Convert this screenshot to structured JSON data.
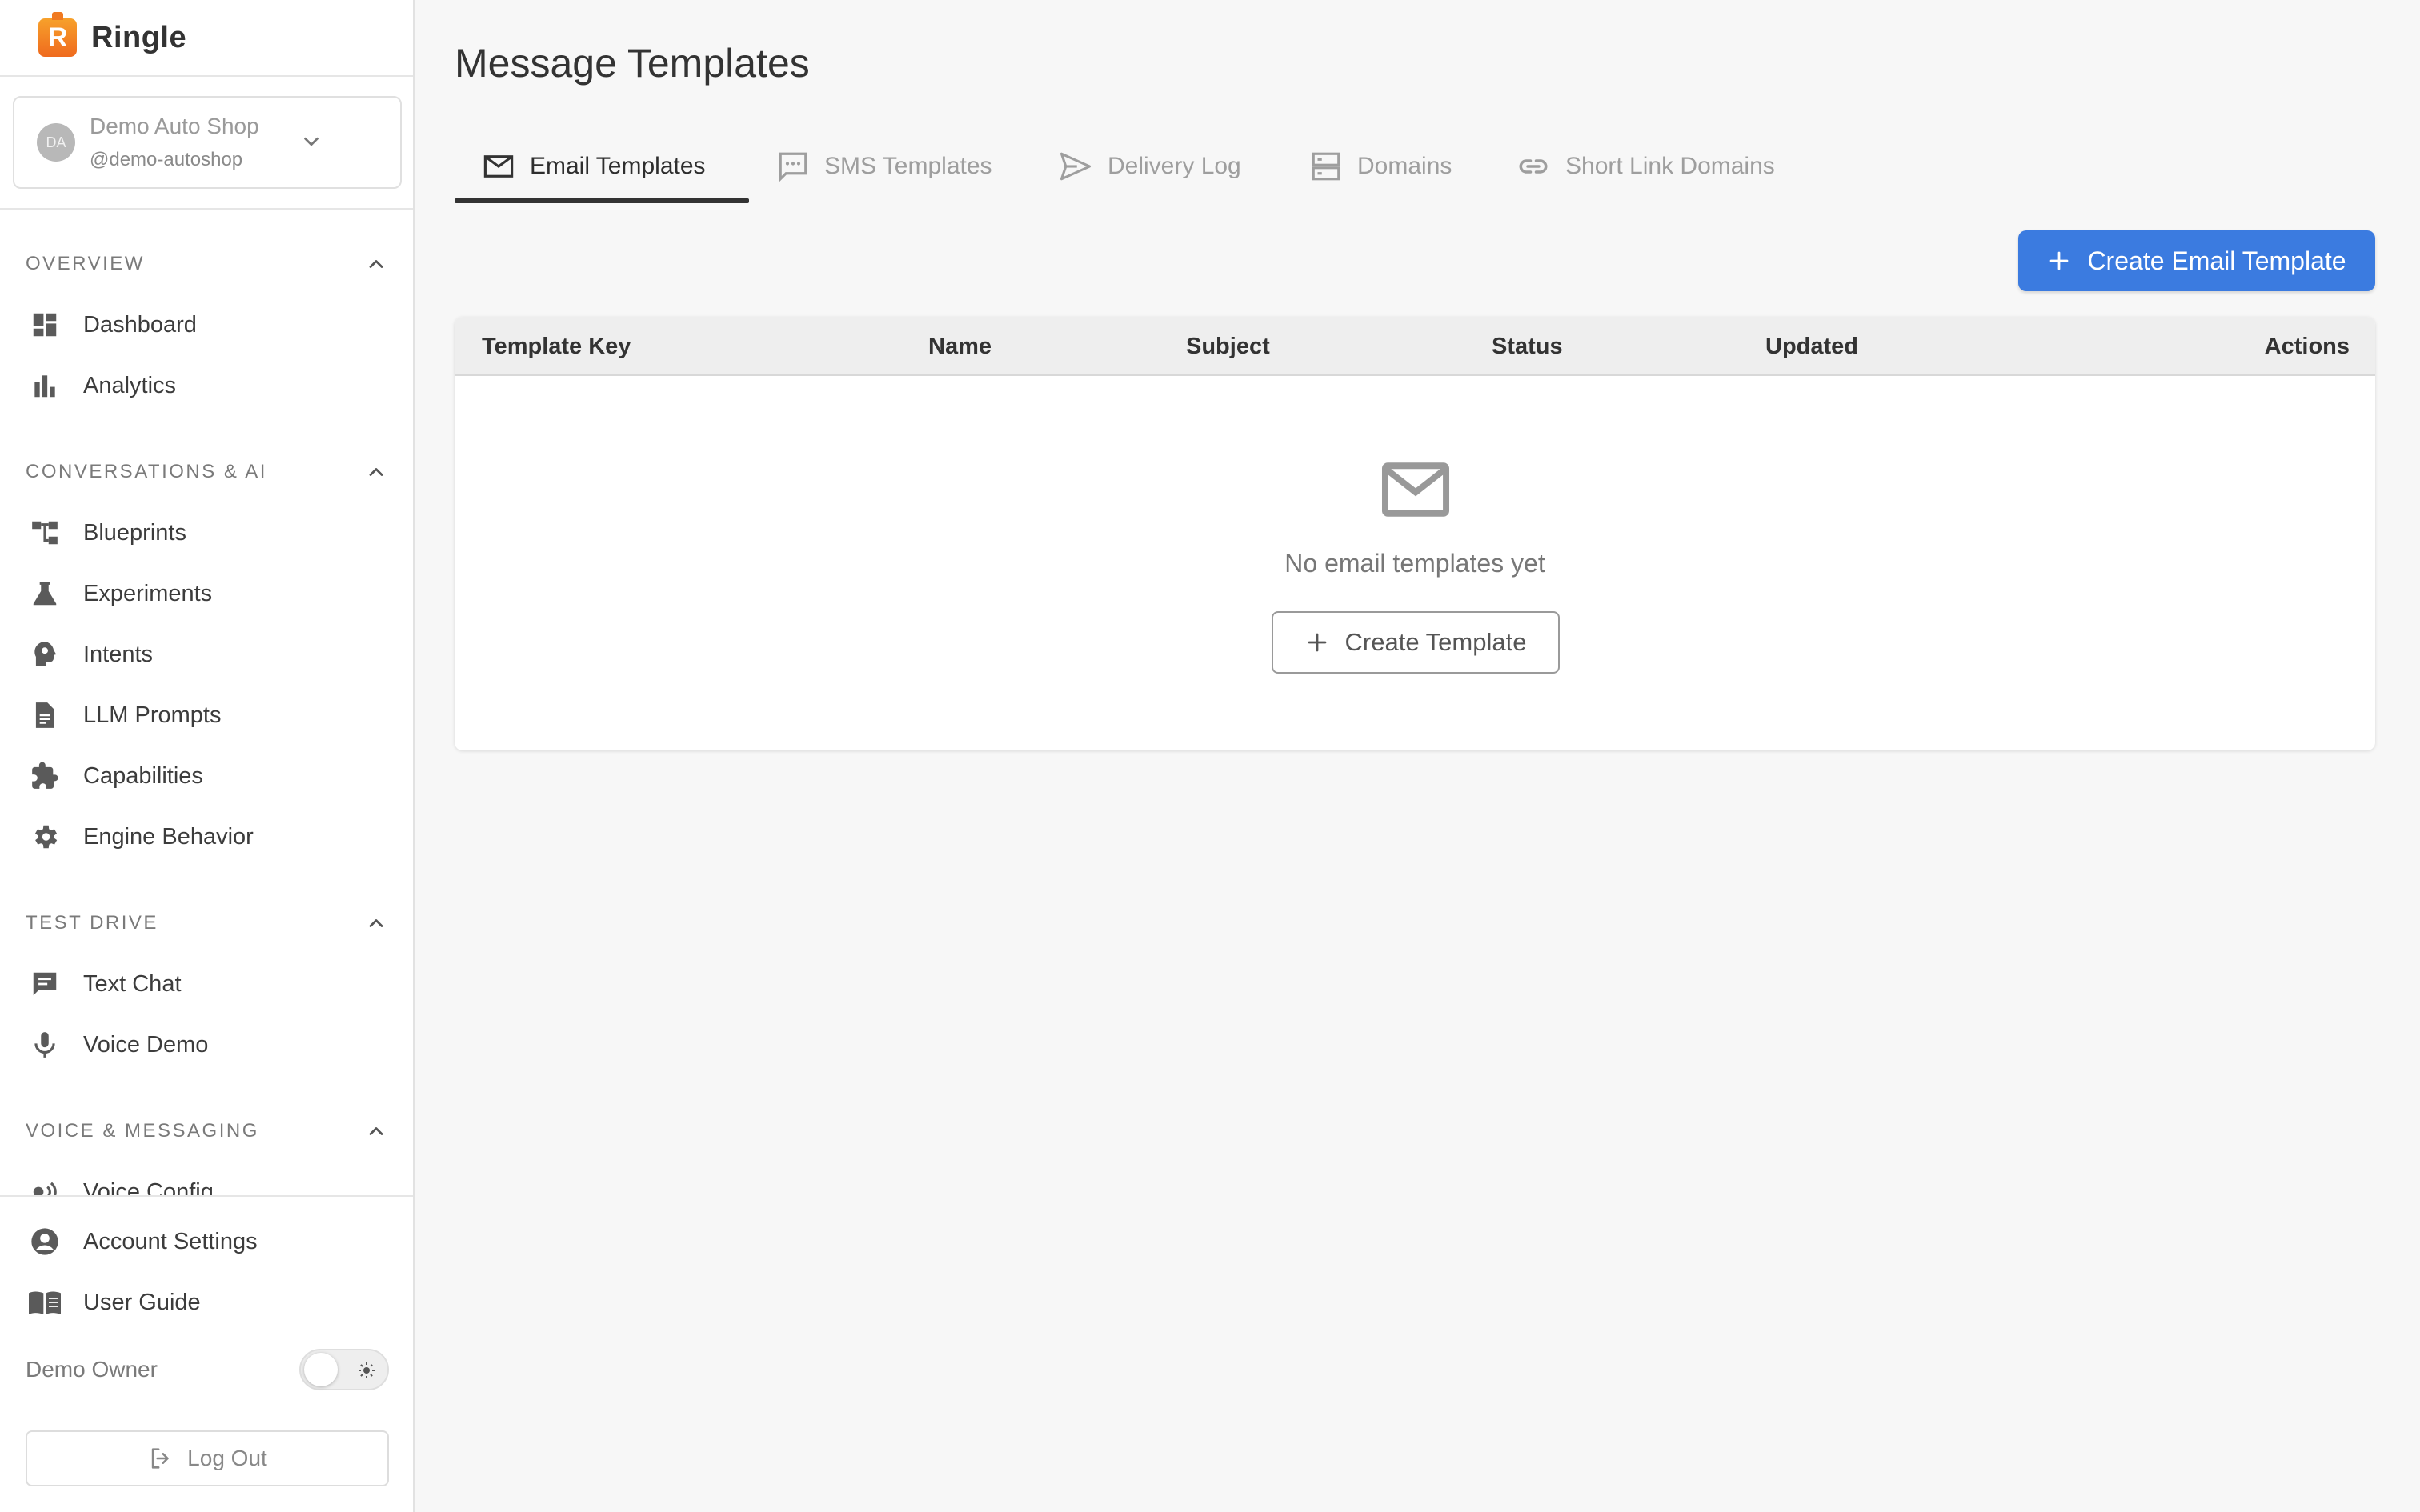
{
  "brand": {
    "logo_letter": "R",
    "name": "Ringle"
  },
  "account": {
    "initials": "DA",
    "name": "Demo Auto Shop",
    "handle": "@demo-autoshop"
  },
  "sections": [
    {
      "title": "OVERVIEW",
      "items": [
        {
          "label": "Dashboard",
          "icon": "dashboard-icon"
        },
        {
          "label": "Analytics",
          "icon": "bar-chart-icon"
        }
      ]
    },
    {
      "title": "CONVERSATIONS & AI",
      "items": [
        {
          "label": "Blueprints",
          "icon": "tree-icon"
        },
        {
          "label": "Experiments",
          "icon": "flask-icon"
        },
        {
          "label": "Intents",
          "icon": "brain-icon"
        },
        {
          "label": "LLM Prompts",
          "icon": "document-icon"
        },
        {
          "label": "Capabilities",
          "icon": "puzzle-icon"
        },
        {
          "label": "Engine Behavior",
          "icon": "gear-icon"
        }
      ]
    },
    {
      "title": "TEST DRIVE",
      "items": [
        {
          "label": "Text Chat",
          "icon": "chat-icon"
        },
        {
          "label": "Voice Demo",
          "icon": "microphone-icon"
        }
      ]
    },
    {
      "title": "VOICE & MESSAGING",
      "items": [
        {
          "label": "Voice Config",
          "icon": "speaker-icon"
        }
      ]
    }
  ],
  "bottom_nav": {
    "account_settings": "Account Settings",
    "user_guide": "User Guide"
  },
  "user": {
    "name": "Demo Owner"
  },
  "logout_label": "Log Out",
  "page": {
    "title": "Message Templates"
  },
  "tabs": [
    {
      "label": "Email Templates",
      "icon": "mail-icon",
      "active": true
    },
    {
      "label": "SMS Templates",
      "icon": "sms-icon",
      "active": false
    },
    {
      "label": "Delivery Log",
      "icon": "send-icon",
      "active": false
    },
    {
      "label": "Domains",
      "icon": "server-icon",
      "active": false
    },
    {
      "label": "Short Link Domains",
      "icon": "link-icon",
      "active": false
    }
  ],
  "create_button": "Create Email Template",
  "table": {
    "columns": [
      "Template Key",
      "Name",
      "Subject",
      "Status",
      "Updated",
      "Actions"
    ],
    "empty_text": "No email templates yet",
    "empty_button": "Create Template"
  },
  "colors": {
    "primary": "#3b7be0",
    "brand": "#ef6a1e",
    "background": "#f7f7f7"
  }
}
